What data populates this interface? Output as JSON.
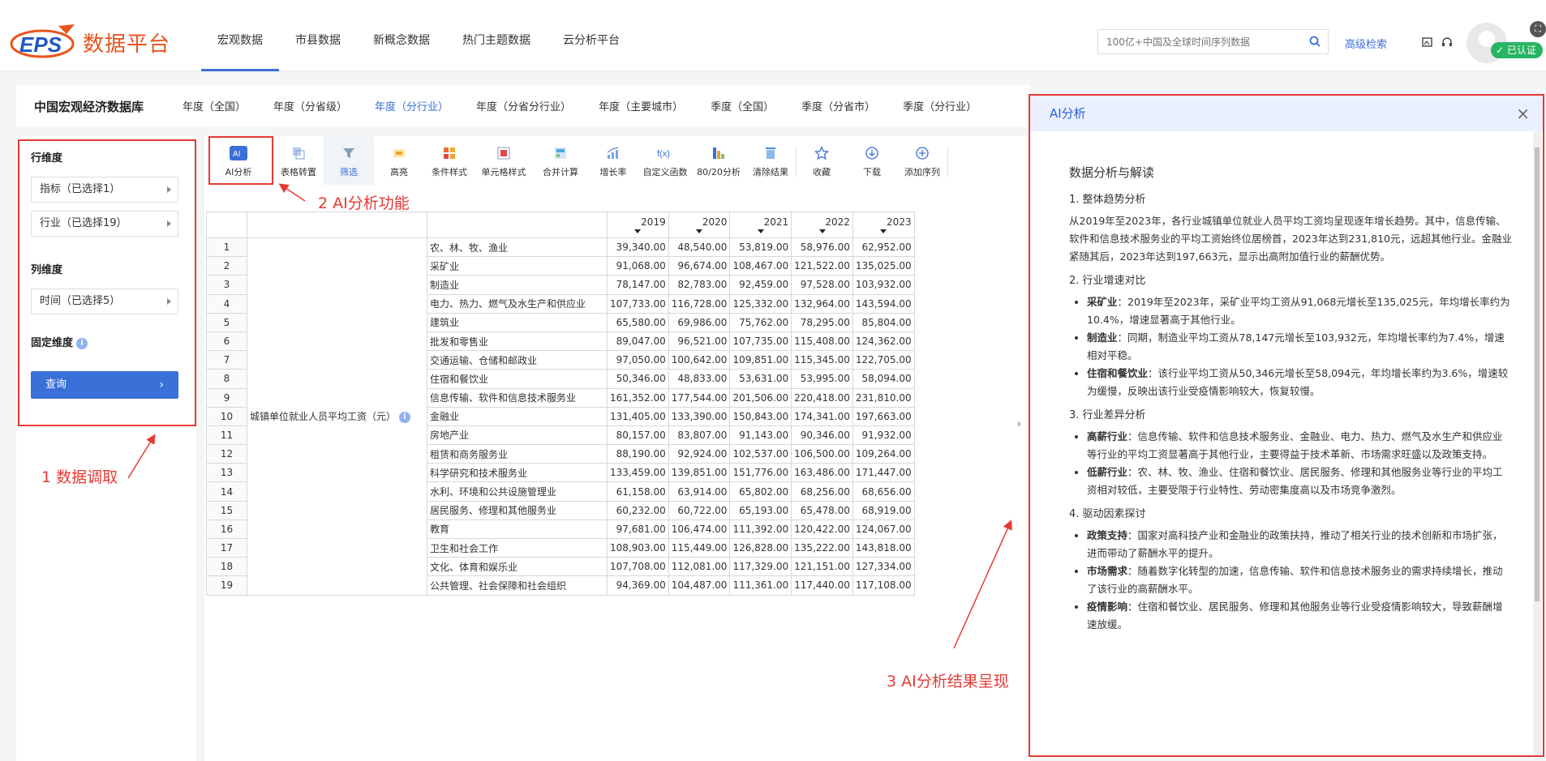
{
  "header": {
    "brand_logo": "EPS",
    "brand_name": "数据平台",
    "nav": [
      "宏观数据",
      "市县数据",
      "新概念数据",
      "热门主题数据",
      "云分析平台"
    ],
    "search_placeholder": "100亿+中国及全球时间序列数据",
    "advanced_search": "高级检索",
    "verified": "已认证"
  },
  "subheader": {
    "title": "中国宏观经济数据库",
    "tabs": [
      "年度（全国）",
      "年度（分省级）",
      "年度（分行业）",
      "年度（分省分行业）",
      "年度（主要城市）",
      "季度（全国）",
      "季度（分省市）",
      "季度（分行业）"
    ],
    "active_tab": "年度（分行业）"
  },
  "left_panel": {
    "row_dim_label": "行维度",
    "row_selects": [
      "指标（已选择1）",
      "行业（已选择19）"
    ],
    "col_dim_label": "列维度",
    "col_selects": [
      "时间（已选择5）"
    ],
    "fixed_dim_label": "固定维度",
    "query_button": "查询"
  },
  "toolbar": {
    "items": [
      "AI分析",
      "表格转置",
      "筛选",
      "高亮",
      "条件样式",
      "单元格样式",
      "合并计算",
      "增长率",
      "自定义函数",
      "80/20分析",
      "清除结果",
      "收藏",
      "下载",
      "添加序列"
    ],
    "active": "筛选"
  },
  "table": {
    "years": [
      "2019",
      "2020",
      "2021",
      "2022",
      "2023"
    ],
    "indicator": "城镇单位就业人员平均工资（元）",
    "rows": [
      {
        "n": "1",
        "industry": "农、林、牧、渔业",
        "values": [
          "39,340.00",
          "48,540.00",
          "53,819.00",
          "58,976.00",
          "62,952.00"
        ]
      },
      {
        "n": "2",
        "industry": "采矿业",
        "values": [
          "91,068.00",
          "96,674.00",
          "108,467.00",
          "121,522.00",
          "135,025.00"
        ]
      },
      {
        "n": "3",
        "industry": "制造业",
        "values": [
          "78,147.00",
          "82,783.00",
          "92,459.00",
          "97,528.00",
          "103,932.00"
        ]
      },
      {
        "n": "4",
        "industry": "电力、热力、燃气及水生产和供应业",
        "values": [
          "107,733.00",
          "116,728.00",
          "125,332.00",
          "132,964.00",
          "143,594.00"
        ]
      },
      {
        "n": "5",
        "industry": "建筑业",
        "values": [
          "65,580.00",
          "69,986.00",
          "75,762.00",
          "78,295.00",
          "85,804.00"
        ]
      },
      {
        "n": "6",
        "industry": "批发和零售业",
        "values": [
          "89,047.00",
          "96,521.00",
          "107,735.00",
          "115,408.00",
          "124,362.00"
        ]
      },
      {
        "n": "7",
        "industry": "交通运输、仓储和邮政业",
        "values": [
          "97,050.00",
          "100,642.00",
          "109,851.00",
          "115,345.00",
          "122,705.00"
        ]
      },
      {
        "n": "8",
        "industry": "住宿和餐饮业",
        "values": [
          "50,346.00",
          "48,833.00",
          "53,631.00",
          "53,995.00",
          "58,094.00"
        ]
      },
      {
        "n": "9",
        "industry": "信息传输、软件和信息技术服务业",
        "values": [
          "161,352.00",
          "177,544.00",
          "201,506.00",
          "220,418.00",
          "231,810.00"
        ]
      },
      {
        "n": "10",
        "industry": "金融业",
        "values": [
          "131,405.00",
          "133,390.00",
          "150,843.00",
          "174,341.00",
          "197,663.00"
        ]
      },
      {
        "n": "11",
        "industry": "房地产业",
        "values": [
          "80,157.00",
          "83,807.00",
          "91,143.00",
          "90,346.00",
          "91,932.00"
        ]
      },
      {
        "n": "12",
        "industry": "租赁和商务服务业",
        "values": [
          "88,190.00",
          "92,924.00",
          "102,537.00",
          "106,500.00",
          "109,264.00"
        ]
      },
      {
        "n": "13",
        "industry": "科学研究和技术服务业",
        "values": [
          "133,459.00",
          "139,851.00",
          "151,776.00",
          "163,486.00",
          "171,447.00"
        ]
      },
      {
        "n": "14",
        "industry": "水利、环境和公共设施管理业",
        "values": [
          "61,158.00",
          "63,914.00",
          "65,802.00",
          "68,256.00",
          "68,656.00"
        ]
      },
      {
        "n": "15",
        "industry": "居民服务、修理和其他服务业",
        "values": [
          "60,232.00",
          "60,722.00",
          "65,193.00",
          "65,478.00",
          "68,919.00"
        ]
      },
      {
        "n": "16",
        "industry": "教育",
        "values": [
          "97,681.00",
          "106,474.00",
          "111,392.00",
          "120,422.00",
          "124,067.00"
        ]
      },
      {
        "n": "17",
        "industry": "卫生和社会工作",
        "values": [
          "108,903.00",
          "115,449.00",
          "126,828.00",
          "135,222.00",
          "143,818.00"
        ]
      },
      {
        "n": "18",
        "industry": "文化、体育和娱乐业",
        "values": [
          "107,708.00",
          "112,081.00",
          "117,329.00",
          "121,151.00",
          "127,334.00"
        ]
      },
      {
        "n": "19",
        "industry": "公共管理、社会保障和社会组织",
        "values": [
          "94,369.00",
          "104,487.00",
          "111,361.00",
          "117,440.00",
          "117,108.00"
        ]
      }
    ]
  },
  "annotations": {
    "a1": "1 数据调取",
    "a2": "2 AI分析功能",
    "a3": "3 AI分析结果呈现"
  },
  "ai_panel": {
    "header": "AI分析",
    "title": "数据分析与解读",
    "sections": [
      {
        "heading": "1. 整体趋势分析",
        "para": "从2019年至2023年，各行业城镇单位就业人员平均工资均呈现逐年增长趋势。其中，信息传输、软件和信息技术服务业的平均工资始终位居榜首，2023年达到231,810元，远超其他行业。金融业紧随其后，2023年达到197,663元，显示出高附加值行业的薪酬优势。"
      },
      {
        "heading": "2. 行业增速对比",
        "items": [
          {
            "k": "采矿业",
            "v": "：2019年至2023年，采矿业平均工资从91,068元增长至135,025元，年均增长率约为10.4%，增速显著高于其他行业。"
          },
          {
            "k": "制造业",
            "v": "：同期，制造业平均工资从78,147元增长至103,932元，年均增长率约为7.4%，增速相对平稳。"
          },
          {
            "k": "住宿和餐饮业",
            "v": "：该行业平均工资从50,346元增长至58,094元，年均增长率约为3.6%，增速较为缓慢，反映出该行业受疫情影响较大，恢复较慢。"
          }
        ]
      },
      {
        "heading": "3. 行业差异分析",
        "items": [
          {
            "k": "高薪行业",
            "v": "：信息传输、软件和信息技术服务业、金融业、电力、热力、燃气及水生产和供应业等行业的平均工资显著高于其他行业，主要得益于技术革新、市场需求旺盛以及政策支持。"
          },
          {
            "k": "低薪行业",
            "v": "：农、林、牧、渔业、住宿和餐饮业、居民服务、修理和其他服务业等行业的平均工资相对较低，主要受限于行业特性、劳动密集度高以及市场竞争激烈。"
          }
        ]
      },
      {
        "heading": "4. 驱动因素探讨",
        "items": [
          {
            "k": "政策支持",
            "v": "：国家对高科技产业和金融业的政策扶持，推动了相关行业的技术创新和市场扩张，进而带动了薪酬水平的提升。"
          },
          {
            "k": "市场需求",
            "v": "：随着数字化转型的加速，信息传输、软件和信息技术服务业的需求持续增长，推动了该行业的高薪酬水平。"
          },
          {
            "k": "疫情影响",
            "v": "：住宿和餐饮业、居民服务、修理和其他服务业等行业受疫情影响较大，导致薪酬增速放缓。"
          }
        ]
      }
    ]
  },
  "colors": {
    "accent": "#3a6fd8",
    "annotation": "#e53935",
    "brand": "#e8541e"
  }
}
